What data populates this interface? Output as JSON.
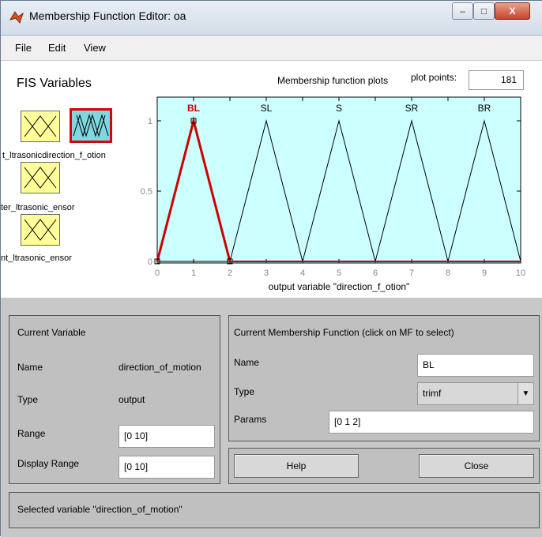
{
  "window": {
    "title": "Membership Function Editor: oa",
    "controls": {
      "minimize": "–",
      "maximize": "□",
      "close": "X"
    }
  },
  "menu": [
    "File",
    "Edit",
    "View"
  ],
  "fis": {
    "title": "FIS Variables",
    "variables": [
      {
        "label": "t_ultrasonic_sensor",
        "selected": false
      },
      {
        "label": "direction_of_motion",
        "selected": true
      },
      {
        "label": "ter_ultrasonic_ensor",
        "selected": false
      },
      {
        "label": "nt_ultrasonic_ensor",
        "selected": false
      }
    ],
    "icon_labels": {
      "row1": "t_ltrasonicdirection_f_otion",
      "row2": "ter_ltrasonic_ensor",
      "row3": "nt_ltrasonic_ensor"
    }
  },
  "plot": {
    "title": "Membership function plots",
    "plot_points_label": "plot points:",
    "plot_points": "181"
  },
  "chart_data": {
    "type": "line",
    "xlabel": "output variable \"direction_f_otion\"",
    "xlim": [
      0,
      10
    ],
    "ylim": [
      0,
      1
    ],
    "xticks": [
      "0",
      "1",
      "2",
      "3",
      "4",
      "5",
      "6",
      "7",
      "8",
      "9",
      "10"
    ],
    "yticks": [
      "0",
      "0.5",
      "1"
    ],
    "background": "#ccffff",
    "series": [
      {
        "name": "BL",
        "x": [
          0,
          1,
          2
        ],
        "y": [
          0,
          1,
          0
        ],
        "color": "#cc0000",
        "selected": true
      },
      {
        "name": "SL",
        "x": [
          2,
          3,
          4
        ],
        "y": [
          0,
          1,
          0
        ],
        "color": "#000000",
        "selected": false
      },
      {
        "name": "S",
        "x": [
          4,
          5,
          6
        ],
        "y": [
          0,
          1,
          0
        ],
        "color": "#000000",
        "selected": false
      },
      {
        "name": "SR",
        "x": [
          6,
          7,
          8
        ],
        "y": [
          0,
          1,
          0
        ],
        "color": "#000000",
        "selected": false
      },
      {
        "name": "BR",
        "x": [
          8,
          9,
          10
        ],
        "y": [
          0,
          1,
          0
        ],
        "color": "#000000",
        "selected": false
      }
    ]
  },
  "current_variable": {
    "title": "Current Variable",
    "name_label": "Name",
    "name_value": "direction_of_motion",
    "type_label": "Type",
    "type_value": "output",
    "range_label": "Range",
    "range_value": "[0 10]",
    "display_range_label": "Display Range",
    "display_range_value": "[0 10]"
  },
  "current_mf": {
    "title": "Current Membership Function (click on MF to select)",
    "name_label": "Name",
    "name_value": "BL",
    "type_label": "Type",
    "type_value": "trimf",
    "params_label": "Params",
    "params_value": "[0 1 2]"
  },
  "buttons": {
    "help": "Help",
    "close": "Close"
  },
  "status": "Selected variable \"direction_of_motion\""
}
